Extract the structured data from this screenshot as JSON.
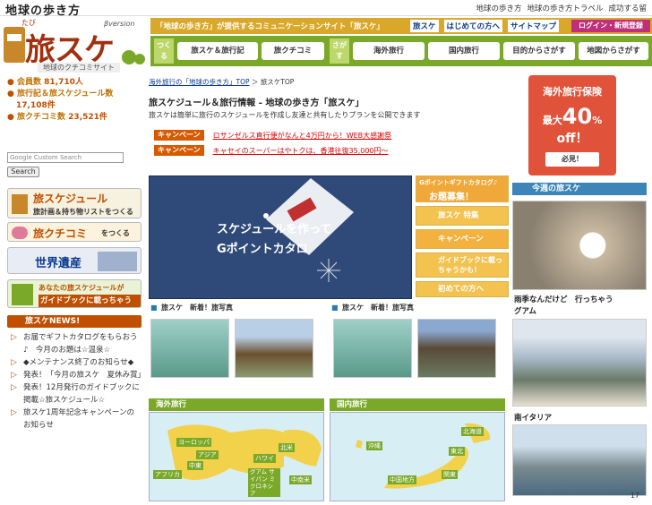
{
  "top": {
    "logo": "地球の歩き方",
    "links": [
      "地球の歩き方",
      "地球の歩き方トラベル",
      "成功する留"
    ]
  },
  "header": {
    "logo_kana": "たび",
    "logo_main": "旅スケ",
    "logo_version": "βversion",
    "logo_sub": "地球のクチコミサイト",
    "banner": "「地球の歩き方」が提供するコミュニケーションサイト「旅スケ」",
    "links": [
      "旅スケ",
      "はじめての方へ",
      "サイトマップ"
    ],
    "login": "ログイン・新規登録"
  },
  "nav": {
    "tag1": "つくる",
    "tag2": "さがす",
    "items": [
      "旅スケ＆旅行記",
      "旅クチコミ",
      "海外旅行",
      "国内旅行",
      "目的からさがす",
      "地図からさがす"
    ]
  },
  "left": {
    "stats": [
      {
        "label": "会員数",
        "value": "81,710人"
      },
      {
        "label": "旅行記＆旅スケジュール数",
        "value": "17,108件"
      },
      {
        "label": "旅クチコミ数",
        "value": "23,521件"
      }
    ],
    "search_placeholder": "Google Custom Search",
    "search_button": "Search",
    "banners": [
      {
        "main": "旅スケジュール",
        "sub": "旅計画＆持ち物リストをつくる"
      },
      {
        "main": "旅クチコミ",
        "sub": "をつくる"
      },
      {
        "main": "世界遺産",
        "sub": ""
      },
      {
        "main": "あなたの旅スケジュールが",
        "sub": "ガイドブックに載っちゃうかも！"
      }
    ],
    "news_title": "旅スケNEWS!",
    "news": [
      "お届でギフトカタログをもらおう♪　今月のお題は☆温泉☆",
      "◆メンテナンス終了のお知らせ◆",
      "発表！「今月の旅スケ　夏休み賞」",
      "発表！12月発行のガイドブックに掲載☆旅スケジュール☆",
      "旅スケ1周年記念キャンペーンのお知らせ"
    ]
  },
  "main": {
    "breadcrumb_link": "海外旅行の「地球の歩き方」TOP",
    "breadcrumb_sep": "＞",
    "breadcrumb_current": "旅スケTOP",
    "title": "旅スケジュール＆旅行情報 - 地球の歩き方「旅スケ」",
    "desc": "旅スケは簡単に旅行のスケジュールを作成し友達と共有したりプランを公開できます",
    "campaigns": [
      {
        "tag": "キャンペーン",
        "text": "ロサンゼルス直行便がなんと4万円から！WEB大感謝祭"
      },
      {
        "tag": "キャンペーン",
        "text": "キャセイのスーパーはやトクは、香港往復35,000円～"
      }
    ],
    "hero_line1": "スケジュールを作って",
    "hero_line2": "Gポイントカタロ",
    "side_buttons": [
      {
        "top": "Gポイントギフトカタログ♪",
        "main": "お題募集！"
      },
      {
        "main": "旅スケ 特集"
      },
      {
        "main": "キャンペーン"
      },
      {
        "main": "ガイドブックに載っちゃうかも！"
      },
      {
        "main": "初めての方へ"
      }
    ],
    "photo_hdr1": "旅スケ　新着！旅写真",
    "photo_hdr2": "旅スケ　新着！旅写真",
    "region1": "海外旅行",
    "region2": "国内旅行",
    "map1_labels": [
      "ヨーロッパ",
      "アジア",
      "北米",
      "ハワイ",
      "中東",
      "アフリカ",
      "グアム サイパン ミクロネシア",
      "中南米"
    ],
    "map2_labels": [
      "北海道",
      "東北",
      "関東",
      "中国地方",
      "沖縄"
    ]
  },
  "right": {
    "ad_title": "海外旅行保険",
    "ad_max": "最大",
    "ad_pct": "40",
    "ad_pct_sign": "%",
    "ad_off": "off！",
    "ad_cta": "必見！",
    "week_title": "今週の旅スケ",
    "cap1": "雨季なんだけど　行っちゃう",
    "cap1b": "グアム",
    "cap2": "南イタリア"
  },
  "page_number": "17"
}
